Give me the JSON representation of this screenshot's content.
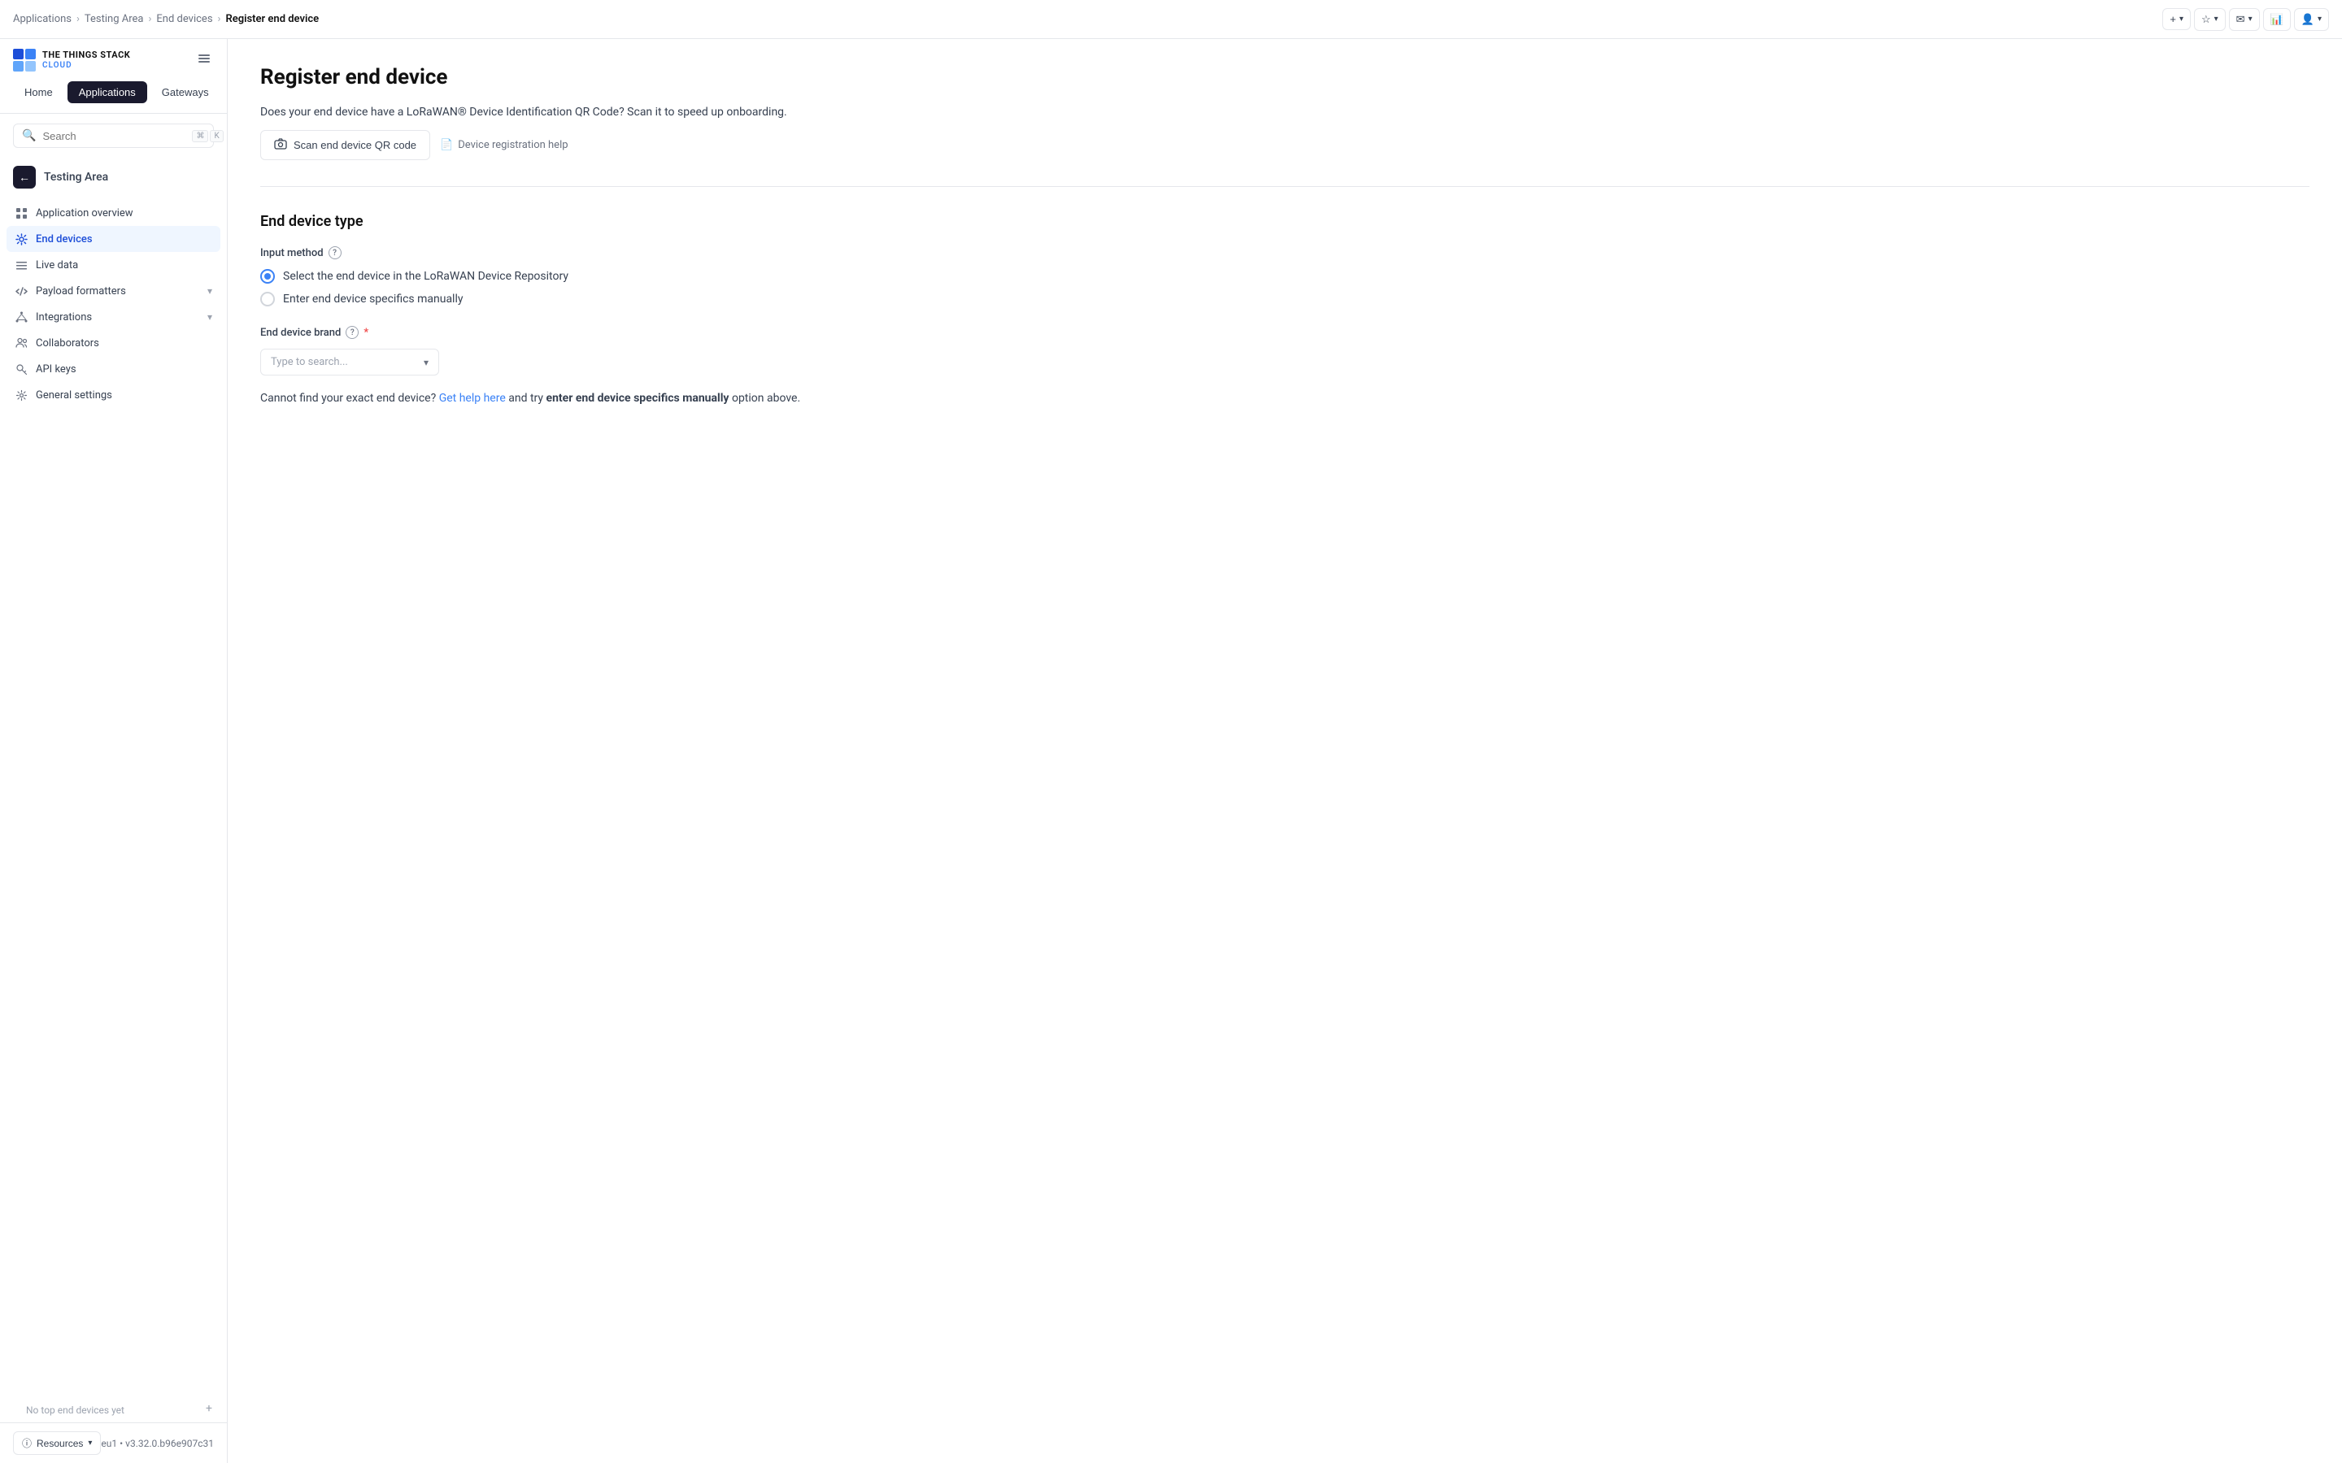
{
  "header": {
    "breadcrumbs": [
      {
        "label": "Applications",
        "href": "#"
      },
      {
        "label": "Testing Area",
        "href": "#"
      },
      {
        "label": "End devices",
        "href": "#"
      },
      {
        "label": "Register end device",
        "current": true
      }
    ],
    "actions": [
      {
        "label": "+",
        "icon": "plus-icon",
        "has_chevron": true
      },
      {
        "label": "★",
        "icon": "bookmark-icon",
        "has_chevron": true
      },
      {
        "label": "✉",
        "icon": "notification-icon",
        "has_chevron": true
      },
      {
        "label": "📊",
        "icon": "stats-icon"
      },
      {
        "label": "👤",
        "icon": "user-icon",
        "has_chevron": true
      }
    ]
  },
  "sidebar": {
    "logo": {
      "title": "THE THINGS STACK",
      "subtitle": "CLOUD"
    },
    "nav_tabs": [
      {
        "label": "Home",
        "active": false
      },
      {
        "label": "Applications",
        "active": true
      },
      {
        "label": "Gateways",
        "active": false
      }
    ],
    "search": {
      "placeholder": "Search",
      "shortcut_keys": [
        "⌘",
        "K"
      ]
    },
    "back_item": {
      "label": "Testing Area"
    },
    "menu_items": [
      {
        "label": "Application overview",
        "icon": "grid-icon",
        "active": false
      },
      {
        "label": "End devices",
        "icon": "settings-icon",
        "active": true
      },
      {
        "label": "Live data",
        "icon": "list-icon",
        "active": false
      },
      {
        "label": "Payload formatters",
        "icon": "code-icon",
        "active": false,
        "has_arrow": true
      },
      {
        "label": "Integrations",
        "icon": "node-icon",
        "active": false,
        "has_arrow": true
      },
      {
        "label": "Collaborators",
        "icon": "users-icon",
        "active": false
      },
      {
        "label": "API keys",
        "icon": "key-icon",
        "active": false
      },
      {
        "label": "General settings",
        "icon": "gear-icon",
        "active": false
      }
    ],
    "section_label": "No top end devices yet",
    "bottom": {
      "resources_label": "Resources",
      "version_text": "eu1 • v3.32.0.b96e907c31"
    }
  },
  "main": {
    "title": "Register end device",
    "qr_section": {
      "description": "Does your end device have a LoRaWAN® Device Identification QR Code? Scan it to speed up onboarding.",
      "scan_btn": "Scan end device QR code",
      "help_link": "Device registration help"
    },
    "device_type": {
      "section_title": "End device type",
      "input_method_label": "Input method",
      "radio_options": [
        {
          "label": "Select the end device in the LoRaWAN Device Repository",
          "checked": true
        },
        {
          "label": "Enter end device specifics manually",
          "checked": false
        }
      ],
      "brand_label": "End device brand",
      "brand_placeholder": "Type to search...",
      "help_text_prefix": "Cannot find your exact end device?",
      "help_link": "Get help here",
      "help_text_middle": "and try",
      "help_bold": "enter end device specifics manually",
      "help_text_suffix": "option above."
    }
  }
}
